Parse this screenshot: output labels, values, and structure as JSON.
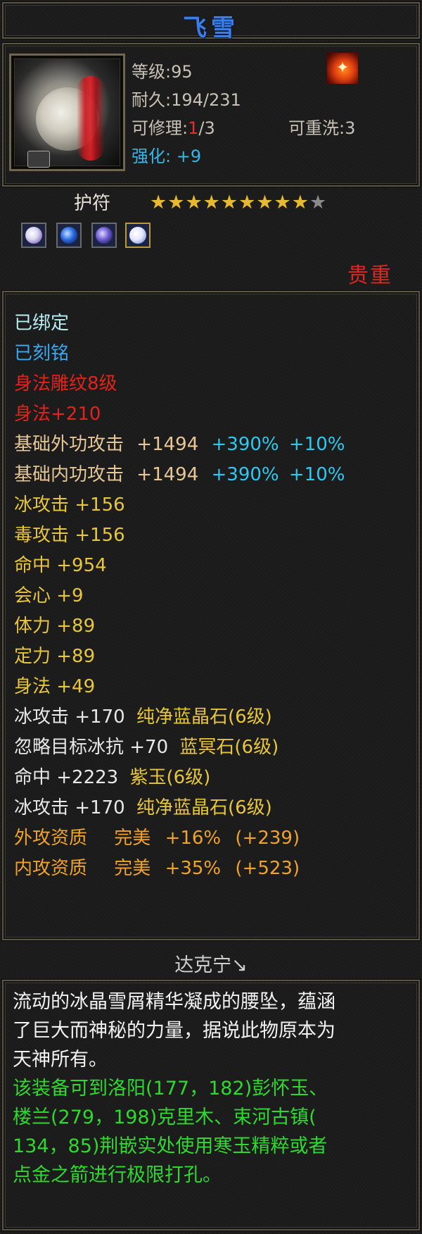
{
  "item": {
    "name": "飞雪",
    "level_label": "等级",
    "level_value": "95",
    "durability_label": "耐久",
    "durability_value": "194/231",
    "repair_label": "可修理",
    "repair_used": "1",
    "repair_total": "/3",
    "rewash_label": "可重洗",
    "rewash_value": "3",
    "enhance_label": "强化",
    "enhance_value": "+9",
    "icon": "white-jade-pendant-icon",
    "rank_icon": "flame-rank-icon",
    "subtype": "护符",
    "stars_total": 10,
    "stars_filled": 9,
    "sockets": [
      {
        "icon": "gem-socket-1-icon",
        "color": "#e6e6f6"
      },
      {
        "icon": "gem-socket-2-icon",
        "color": "#2a6ae0"
      },
      {
        "icon": "gem-socket-3-icon",
        "color": "#6a5ad0"
      },
      {
        "icon": "gem-socket-4-icon",
        "color": "#f2f2ff"
      }
    ],
    "precious_label": "贵重"
  },
  "attributes": [
    {
      "text": "已绑定",
      "color": "#b6eef2"
    },
    {
      "text": "已刻铭",
      "color": "#3aa8f0"
    },
    {
      "text": "身法雕纹8级",
      "color": "#e3221c"
    },
    {
      "text": "身法+210",
      "color": "#e3221c"
    }
  ],
  "base_attack_outer": {
    "label": "基础外功攻击",
    "value": "+1494",
    "pct": "+390%",
    "extra": "+10%"
  },
  "base_attack_inner": {
    "label": "基础内功攻击",
    "value": "+1494",
    "pct": "+390%",
    "extra": "+10%"
  },
  "stats": [
    {
      "text": "冰攻击 +156"
    },
    {
      "text": "毒攻击 +156"
    },
    {
      "text": "命中 +954"
    },
    {
      "text": "会心 +9"
    },
    {
      "text": "体力 +89"
    },
    {
      "text": "定力 +89"
    },
    {
      "text": "身法 +49"
    }
  ],
  "gem_stats": [
    {
      "label": "冰攻击 +170",
      "gem": "纯净蓝晶石(6级)"
    },
    {
      "label": "忽略目标冰抗 +70",
      "gem": "蓝冥石(6级)"
    },
    {
      "label": "命中 +2223",
      "gem": "紫玉(6级)"
    },
    {
      "label": "冰攻击 +170",
      "gem": "纯净蓝晶石(6级)"
    }
  ],
  "qualities": [
    {
      "label": "外攻资质",
      "grade": "完美",
      "pct": "+16%",
      "value": "(+239)"
    },
    {
      "label": "内攻资质",
      "grade": "完美",
      "pct": "+35%",
      "value": "(+523)"
    }
  ],
  "owner": "达克宁↘",
  "description": {
    "white_lines": [
      "流动的冰晶雪屑精华凝成的腰坠，蕴涵",
      "了巨大而神秘的力量，据说此物原本为",
      "天神所有。"
    ],
    "green_lines": [
      "该装备可到洛阳(177，182)彭怀玉、",
      "楼兰(279，198)克里木、束河古镇(",
      "134，85)荆嵌实处使用寒玉精粹或者",
      "点金之箭进行极限打孔。"
    ]
  }
}
